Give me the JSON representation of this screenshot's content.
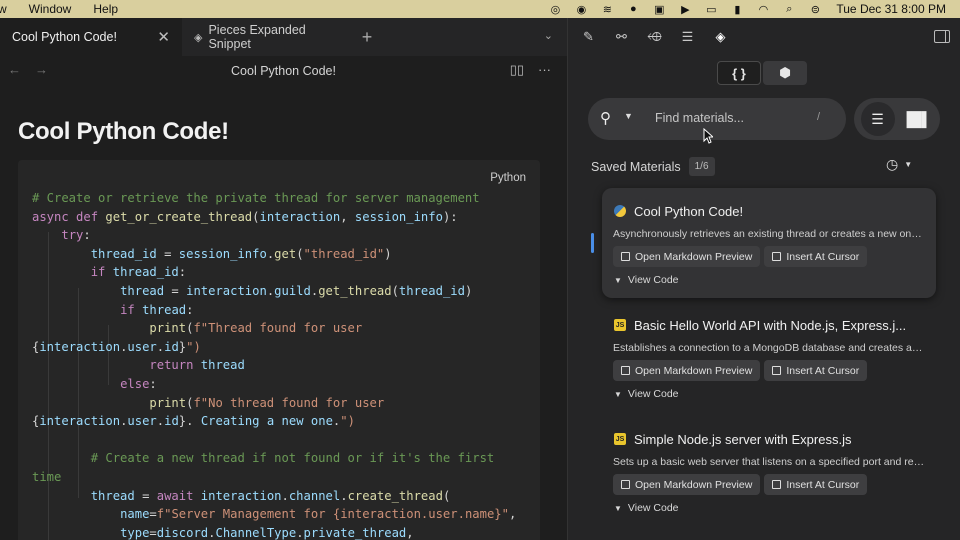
{
  "menubar": {
    "menus": [
      "w",
      "Window",
      "Help"
    ],
    "clock": "Tue Dec 31  8:00 PM"
  },
  "editor": {
    "tabs": [
      {
        "label": "Cool Python Code!",
        "active": true
      },
      {
        "label": "Pieces Expanded Snippet",
        "active": false
      }
    ],
    "doc_title": "Cool Python Code!",
    "heading": "Cool Python Code!",
    "language": "Python",
    "code_lines": [
      "# Create or retrieve the private thread for server management",
      "async def get_or_create_thread(interaction, session_info):",
      "    try:",
      "        thread_id = session_info.get(\"thread_id\")",
      "        if thread_id:",
      "            thread = interaction.guild.get_thread(thread_id)",
      "            if thread:",
      "                print(f\"Thread found for user",
      "{interaction.user.id}\")",
      "                return thread",
      "            else:",
      "                print(f\"No thread found for user",
      "{interaction.user.id}. Creating a new one.\")",
      "",
      "        # Create a new thread if not found or if it's the first",
      "time",
      "        thread = await interaction.channel.create_thread(",
      "            name=f\"Server Management for {interaction.user.name}\",",
      "            type=discord.ChannelType.private_thread,"
    ]
  },
  "pieces": {
    "search_placeholder": "Find materials...",
    "search_shortcut": "/",
    "saved_label": "Saved Materials",
    "saved_count": "1/6",
    "materials": [
      {
        "title": "Cool Python Code!",
        "lang_icon": "python-icon",
        "description": "Asynchronously retrieves an existing thread or creates a new one b...",
        "btn_preview": "Open Markdown Preview",
        "btn_insert": "Insert At Cursor",
        "view_code": "View Code"
      },
      {
        "title": "Basic Hello World API with Node.js, Express.j...",
        "lang_icon": "javascript-icon",
        "description": "Establishes a connection to a MongoDB database and creates a si...",
        "btn_preview": "Open Markdown Preview",
        "btn_insert": "Insert At Cursor",
        "view_code": "View Code"
      },
      {
        "title": "Simple Node.js server with Express.js",
        "lang_icon": "javascript-icon",
        "description": "Sets up a basic web server that listens on a specified port and resp...",
        "btn_preview": "Open Markdown Preview",
        "btn_insert": "Insert At Cursor",
        "view_code": "View Code"
      }
    ]
  },
  "colors": {
    "menubar": "#d9cf9e",
    "accent": "#4a8fe8",
    "keyword": "#c586c0",
    "function": "#dcdcaa",
    "string": "#ce9178",
    "variable": "#9cdcfe",
    "comment": "#6a9955"
  }
}
